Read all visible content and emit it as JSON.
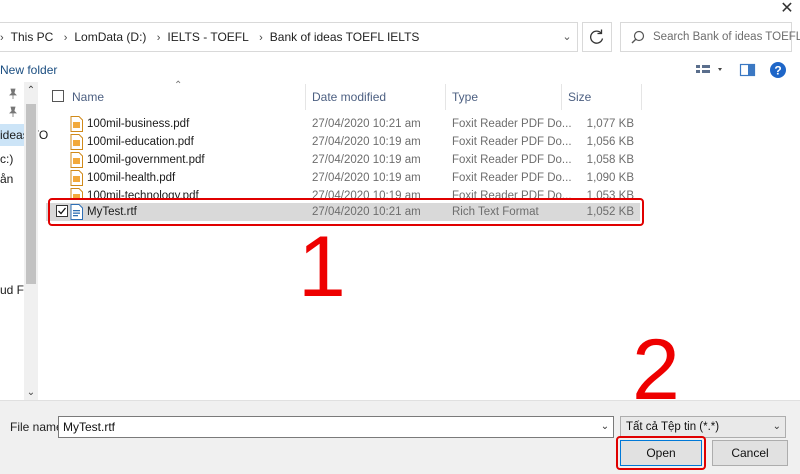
{
  "address": {
    "crumbs": [
      "This PC",
      "LomData (D:)",
      "IELTS - TOEFL",
      "Bank of ideas TOEFL IELTS"
    ]
  },
  "search": {
    "placeholder": "Search Bank of ideas TOEFL I..."
  },
  "toolbar": {
    "new_folder_label": "New folder"
  },
  "nav": {
    "items": [
      "ideas TO",
      "c:)",
      "ån",
      "ud Fi"
    ]
  },
  "columns": {
    "name": "Name",
    "date": "Date modified",
    "type": "Type",
    "size": "Size"
  },
  "files": [
    {
      "name": "100mil-business.pdf",
      "date": "27/04/2020 10:21 am",
      "type": "Foxit Reader PDF Do...",
      "size": "1,077 KB",
      "icon": "pdf-icon"
    },
    {
      "name": "100mil-education.pdf",
      "date": "27/04/2020 10:19 am",
      "type": "Foxit Reader PDF Do...",
      "size": "1,056 KB",
      "icon": "pdf-icon"
    },
    {
      "name": "100mil-government.pdf",
      "date": "27/04/2020 10:19 am",
      "type": "Foxit Reader PDF Do...",
      "size": "1,058 KB",
      "icon": "pdf-icon"
    },
    {
      "name": "100mil-health.pdf",
      "date": "27/04/2020 10:19 am",
      "type": "Foxit Reader PDF Do...",
      "size": "1,090 KB",
      "icon": "pdf-icon"
    },
    {
      "name": "100mil-technology.pdf",
      "date": "27/04/2020 10:19 am",
      "type": "Foxit Reader PDF Do...",
      "size": "1,053 KB",
      "icon": "pdf-icon"
    },
    {
      "name": "MyTest.rtf",
      "date": "27/04/2020 10:21 am",
      "type": "Rich Text Format",
      "size": "1,052 KB",
      "icon": "rtf-icon",
      "selected": true
    }
  ],
  "annotations": {
    "step1": "1",
    "step2": "2"
  },
  "bottom": {
    "file_name_label": "File name:",
    "file_name_value": "MyTest.rtf",
    "file_type_value": "Tất cả Tệp tin (*.*)",
    "open_label": "Open",
    "cancel_label": "Cancel"
  },
  "colors": {
    "annotation": "#ee0000",
    "selected_row": "#d9d9d9",
    "header_text": "#4d6082",
    "accent": "#0078d7"
  }
}
